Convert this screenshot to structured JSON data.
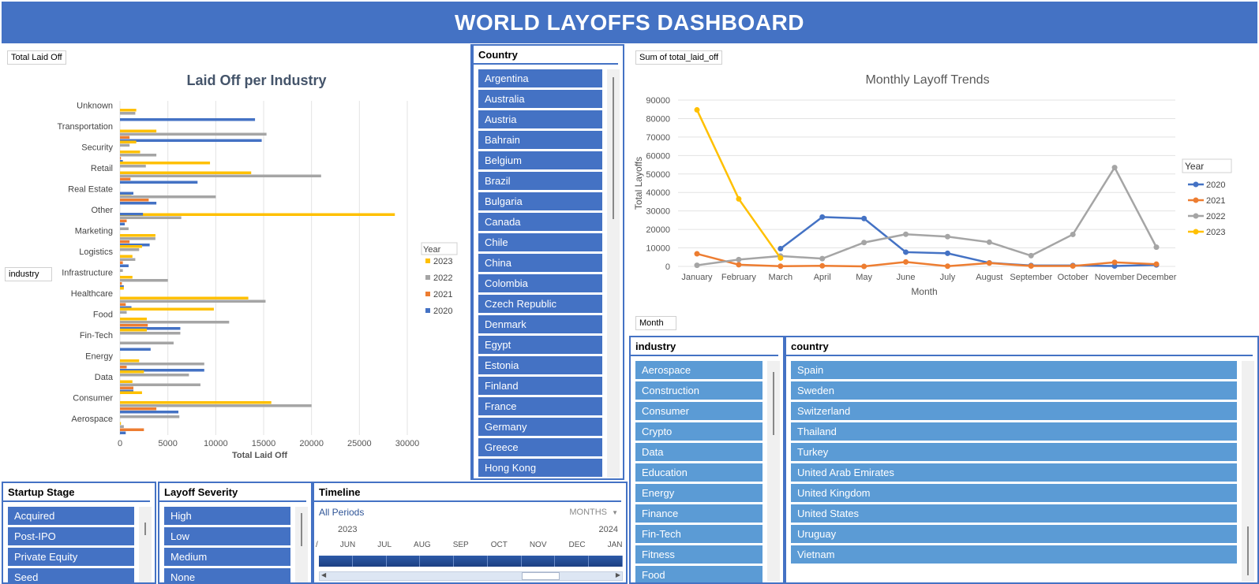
{
  "header": {
    "title": "WORLD LAYOFFS DASHBOARD"
  },
  "left_chart": {
    "field_chip": "Total Laid Off",
    "row_chip": "industry"
  },
  "right_chart": {
    "field_chip": "Sum of total_laid_off",
    "axis_chip": "Month"
  },
  "chart_data": [
    {
      "type": "bar",
      "orientation": "horizontal",
      "title": "Laid Off per Industry",
      "xlabel": "Total Laid Off",
      "ylabel": "",
      "xlim": [
        0,
        30000
      ],
      "xticks": [
        0,
        5000,
        10000,
        15000,
        20000,
        25000,
        30000
      ],
      "grid": true,
      "legend_title": "Year",
      "legend_position": "right",
      "categories": [
        "Unknown",
        "Transportation",
        "Security",
        "Retail",
        "Real Estate",
        "Other",
        "Marketing",
        "Logistics",
        "Infrastructure",
        "Healthcare",
        "Food",
        "Fin-Tech",
        "Energy",
        "Data",
        "Consumer",
        "Aerospace"
      ],
      "series": [
        {
          "name": "2023",
          "color": "#ffc000",
          "values": [
            1700,
            3800,
            2100,
            13700,
            1200,
            28700,
            3700,
            1300,
            1300,
            13400,
            2800,
            0,
            2000,
            1300,
            15800,
            100
          ]
        },
        {
          "name": "2022",
          "color": "#a5a5a5",
          "values": [
            1600,
            15300,
            3800,
            21000,
            10000,
            6400,
            3700,
            1600,
            5000,
            15200,
            11400,
            5600,
            8800,
            8400,
            20000,
            400
          ]
        },
        {
          "name": "2021",
          "color": "#ed7d31",
          "values": [
            0,
            1000,
            100,
            1100,
            3000,
            700,
            1000,
            300,
            200,
            600,
            2900,
            0,
            700,
            1400,
            3800,
            2500
          ]
        },
        {
          "name": "2020",
          "color": "#4472c4",
          "values": [
            14100,
            14800,
            300,
            8100,
            3800,
            500,
            3100,
            900,
            400,
            1200,
            6300,
            3200,
            8800,
            1400,
            6100,
            600
          ]
        }
      ],
      "extra_bars": [
        {
          "category": "Transportation",
          "series": "2023",
          "value": 1700
        },
        {
          "category": "Transportation",
          "series": "2022",
          "value": 1000
        },
        {
          "category": "Security",
          "series": "2023",
          "value": 9400
        },
        {
          "category": "Security",
          "series": "2022",
          "value": 2700
        },
        {
          "category": "Retail",
          "series": "2020",
          "value": 1400
        },
        {
          "category": "Real Estate",
          "series": "2020",
          "value": 2400
        },
        {
          "category": "Other",
          "series": "2022",
          "value": 900
        },
        {
          "category": "Marketing",
          "series": "2023",
          "value": 2300
        },
        {
          "category": "Marketing",
          "series": "2022",
          "value": 2000
        },
        {
          "category": "Logistics",
          "series": "2022",
          "value": 300
        },
        {
          "category": "Infrastructure",
          "series": "2023",
          "value": 400
        },
        {
          "category": "Healthcare",
          "series": "2023",
          "value": 9800
        },
        {
          "category": "Healthcare",
          "series": "2022",
          "value": 700
        },
        {
          "category": "Food",
          "series": "2023",
          "value": 2800
        },
        {
          "category": "Food",
          "series": "2022",
          "value": 6300
        },
        {
          "category": "Energy",
          "series": "2023",
          "value": 2500
        },
        {
          "category": "Energy",
          "series": "2022",
          "value": 7200
        },
        {
          "category": "Data",
          "series": "2023",
          "value": 2300
        },
        {
          "category": "Consumer",
          "series": "2022",
          "value": 6200
        }
      ]
    },
    {
      "type": "line",
      "title": "Monthly Layoff Trends",
      "xlabel": "Month",
      "ylabel": "Total Layoffs",
      "ylim": [
        0,
        90000
      ],
      "yticks": [
        0,
        10000,
        20000,
        30000,
        40000,
        50000,
        60000,
        70000,
        80000,
        90000
      ],
      "grid": true,
      "legend_title": "Year",
      "legend_position": "right",
      "x": [
        "January",
        "February",
        "March",
        "April",
        "May",
        "June",
        "July",
        "August",
        "September",
        "October",
        "November",
        "December"
      ],
      "series": [
        {
          "name": "2020",
          "color": "#4472c4",
          "values": [
            null,
            null,
            9600,
            26700,
            25900,
            7700,
            7100,
            1900,
            500,
            500,
            200,
            800
          ]
        },
        {
          "name": "2021",
          "color": "#ed7d31",
          "values": [
            6800,
            900,
            100,
            300,
            0,
            2400,
            100,
            1800,
            200,
            200,
            2200,
            1200
          ]
        },
        {
          "name": "2022",
          "color": "#a5a5a5",
          "values": [
            600,
            3700,
            5600,
            4200,
            12900,
            17400,
            16100,
            13100,
            5800,
            17300,
            53500,
            10400
          ]
        },
        {
          "name": "2023",
          "color": "#ffc000",
          "values": [
            84700,
            36500,
            4500,
            null,
            null,
            null,
            null,
            null,
            null,
            null,
            null,
            null
          ]
        }
      ]
    }
  ],
  "slicers": {
    "country": {
      "title": "Country",
      "items": [
        "Argentina",
        "Australia",
        "Austria",
        "Bahrain",
        "Belgium",
        "Brazil",
        "Bulgaria",
        "Canada",
        "Chile",
        "China",
        "Colombia",
        "Czech Republic",
        "Denmark",
        "Egypt",
        "Estonia",
        "Finland",
        "France",
        "Germany",
        "Greece",
        "Hong Kong"
      ]
    },
    "industry": {
      "title": "industry",
      "items": [
        "Aerospace",
        "Construction",
        "Consumer",
        "Crypto",
        "Data",
        "Education",
        "Energy",
        "Finance",
        "Fin-Tech",
        "Fitness",
        "Food"
      ]
    },
    "country2": {
      "title": "country",
      "items": [
        "Spain",
        "Sweden",
        "Switzerland",
        "Thailand",
        "Turkey",
        "United Arab Emirates",
        "United Kingdom",
        "United States",
        "Uruguay",
        "Vietnam"
      ]
    },
    "startup": {
      "title": "Startup Stage",
      "items": [
        "Acquired",
        "Post-IPO",
        "Private Equity",
        "Seed"
      ]
    },
    "severity": {
      "title": "Layoff Severity",
      "items": [
        "High",
        "Low",
        "Medium",
        "None"
      ]
    }
  },
  "timeline": {
    "title": "Timeline",
    "period": "All Periods",
    "level": "MONTHS",
    "level_icon": "caret-down-icon",
    "year_left": "2023",
    "year_right": "2024",
    "months": [
      "/",
      "JUN",
      "JUL",
      "AUG",
      "SEP",
      "OCT",
      "NOV",
      "DEC",
      "JAN"
    ],
    "scroll_left": "◀",
    "scroll_right": "▶"
  }
}
